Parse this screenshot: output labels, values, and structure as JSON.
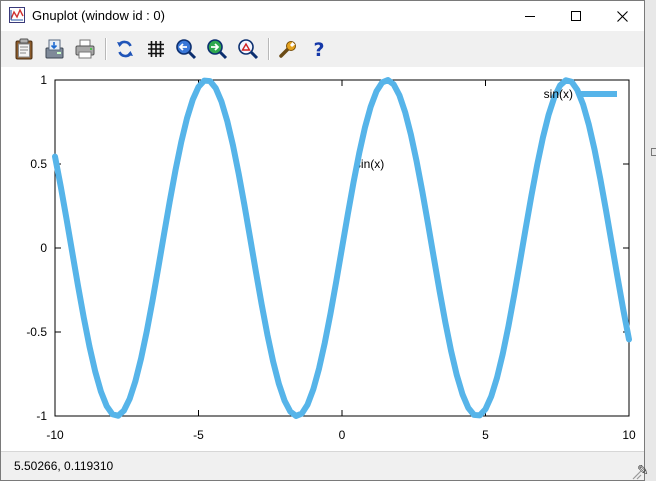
{
  "window": {
    "title": "Gnuplot (window id : 0)",
    "controls": [
      "minimize",
      "maximize",
      "close"
    ]
  },
  "toolbar": {
    "buttons": [
      {
        "name": "copy-clipboard-button",
        "icon": "clipboard-icon"
      },
      {
        "name": "export-button",
        "icon": "export-icon"
      },
      {
        "name": "print-button",
        "icon": "printer-icon"
      },
      {
        "name": "replot-button",
        "icon": "refresh-icon"
      },
      {
        "name": "grid-button",
        "icon": "grid-icon"
      },
      {
        "name": "previous-zoom-button",
        "icon": "zoom-previous-icon"
      },
      {
        "name": "next-zoom-button",
        "icon": "zoom-next-icon"
      },
      {
        "name": "autoscale-button",
        "icon": "zoom-autoscale-icon"
      },
      {
        "name": "options-button",
        "icon": "wrench-icon"
      },
      {
        "name": "help-button",
        "icon": "help-icon"
      }
    ]
  },
  "statusbar": {
    "coordinates": "5.50266,  0.119310"
  },
  "chart_data": {
    "type": "line",
    "function": "sin(x)",
    "label": "sin(x)",
    "legend": {
      "entry": "sin(x)",
      "placement": "top-right"
    },
    "xlim": [
      -10,
      10
    ],
    "ylim": [
      -1,
      1
    ],
    "xticks": [
      "-10",
      "-5",
      "0",
      "5",
      "10"
    ],
    "yticks": [
      "1",
      "0.5",
      "0",
      "-0.5",
      "-1"
    ],
    "xtick_values": [
      -10,
      -5,
      0,
      5,
      10
    ],
    "ytick_values": [
      1,
      0.5,
      0,
      -0.5,
      -1
    ],
    "grid": false,
    "series": [
      {
        "name": "sin(x)",
        "color": "#56b4e9",
        "samples": 100
      }
    ]
  }
}
